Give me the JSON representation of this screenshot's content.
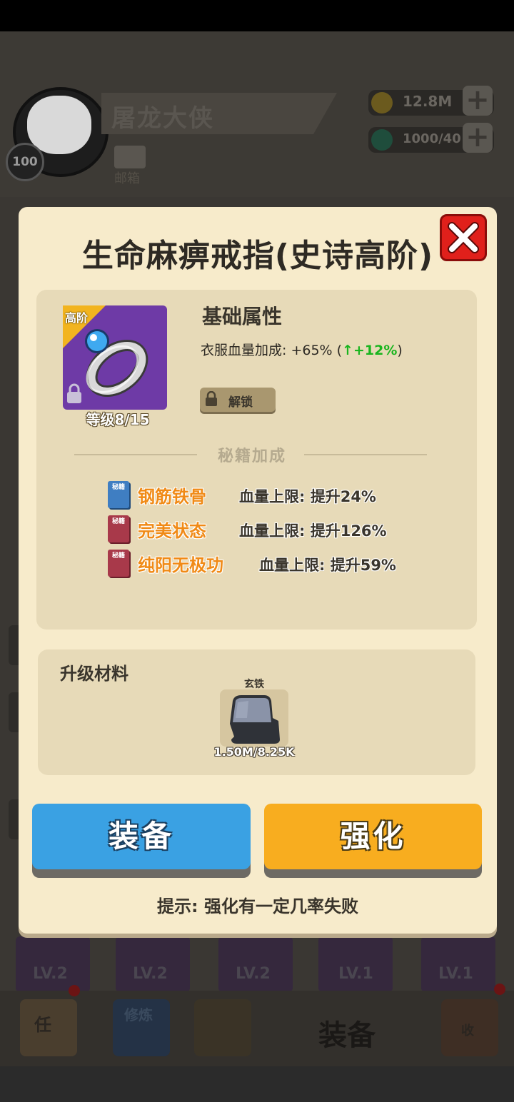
{
  "background": {
    "player": {
      "name": "屠龙大侠",
      "level": "100",
      "mail_label": "邮箱"
    },
    "resources": [
      {
        "icon": "gold-coin-icon",
        "value": "12.8M"
      },
      {
        "icon": "gem-icon",
        "value": "1000/40"
      }
    ],
    "equip_slots": [
      "LV.2",
      "LV.2",
      "LV.2",
      "LV.1",
      "LV.1"
    ],
    "nav": [
      {
        "icon": "task-scroll-icon",
        "label": "任"
      },
      {
        "icon": "cultivate-book-icon",
        "label": "修炼"
      },
      {
        "icon": "crossed-swords-icon",
        "label": ""
      },
      {
        "icon": "equipment-icon",
        "label": "装备"
      },
      {
        "icon": "collect-chest-icon",
        "label": "收"
      }
    ]
  },
  "dialog": {
    "title": "生命麻痹戒指(史诗高阶)",
    "item": {
      "tier": "高阶",
      "level": "等级8/15",
      "icon": "ring-icon"
    },
    "base_attr_title": "基础属性",
    "attr": {
      "label": "衣服血量加成: +65% (",
      "arrow": "↑",
      "bonus": "+12%",
      "close": ")"
    },
    "unlock_label": "解锁",
    "secret_title": "秘籍加成",
    "skills": [
      {
        "book_color": "#3f7ec2",
        "book_text": "秘籍",
        "name": "钢筋铁骨",
        "effect": "血量上限: 提升24%"
      },
      {
        "book_color": "#a8394a",
        "book_text": "秘籍",
        "name": "完美状态",
        "effect": "血量上限: 提升126%"
      },
      {
        "book_color": "#a8394a",
        "book_text": "秘籍",
        "name": "纯阳无极功",
        "effect": "血量上限: 提升59%"
      }
    ],
    "material_title": "升级材料",
    "material": {
      "name": "玄铁",
      "count": "1.50M/8.25K",
      "icon": "iron-ore-icon"
    },
    "buttons": {
      "equip": "装备",
      "enhance": "强化"
    },
    "hint": "提示: 强化有一定几率失败"
  },
  "colors": {
    "equip_button": "#3aa1e3",
    "enhance_button": "#f8ad1f",
    "close_button": "#e0201b",
    "skill_name": "#f08a16",
    "bonus_green": "#19b51e",
    "item_frame": "#6e3aa6"
  }
}
